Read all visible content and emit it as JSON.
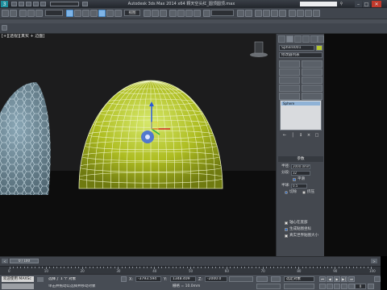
{
  "window": {
    "title": "Autodesk 3ds Max  2014 x64    颗天空头红_圆顶圆顶.max",
    "search_placeholder": "",
    "minimize_glyph": "–",
    "maximize_glyph": "□",
    "close_glyph": "✕"
  },
  "toolbar": {
    "view_dropdown": "视图"
  },
  "viewport": {
    "label": "[+][透视][真实 + 边面]",
    "colors": {
      "background": "#1c1c1d",
      "floor": "#0d0d0d",
      "dome_light": "#d6e86a",
      "dome_dark": "#6f7a10",
      "glass_dome": "#6d8796"
    }
  },
  "command_panel": {
    "object_name": "Sphere001",
    "modifier_list": "修改器列表",
    "modifier_buttons": [
      "",
      "",
      "",
      "",
      "",
      "",
      "",
      "",
      "",
      ""
    ],
    "stack_item": "Sphere",
    "stack_tool_glyphs": [
      "←",
      "│",
      "↕",
      "×",
      "□"
    ],
    "params_header": "参数",
    "radius_label": "半径:",
    "radius_value": "2000.0mm",
    "segments_label": "分段:",
    "segments_value": "32",
    "smooth_label": "平滑",
    "hemisphere_label": "半球:",
    "hemisphere_value": "0.5",
    "chop_label": "切除",
    "squash_label": "挤压",
    "base_to_pivot_label": "轴心在底部",
    "gen_mapping_label": "生成贴图坐标",
    "real_world_label": "真实世界贴图大小"
  },
  "timeline": {
    "slider_label": "0 / 100",
    "ticks": [
      "0",
      "10",
      "20",
      "30",
      "40",
      "50",
      "60",
      "70",
      "80",
      "90",
      "100"
    ]
  },
  "status": {
    "script_label": "欢迎使用 MAXSc",
    "selection_text": "选择了 1 个 对象",
    "prompt_text": "单击并拖动以选择并移动对象",
    "x_label": "X:",
    "x_value": "-3793.594",
    "y_label": "Y:",
    "y_value": "1348.409",
    "z_label": "Z:",
    "z_value": "-2000.0",
    "grid_text": "栅格 = 10.0mm",
    "selected_dropdown": "选定对象",
    "frame_value": "0",
    "playback_glyphs": [
      "⏮",
      "◀",
      "▶",
      "▶│",
      "⏭"
    ]
  }
}
